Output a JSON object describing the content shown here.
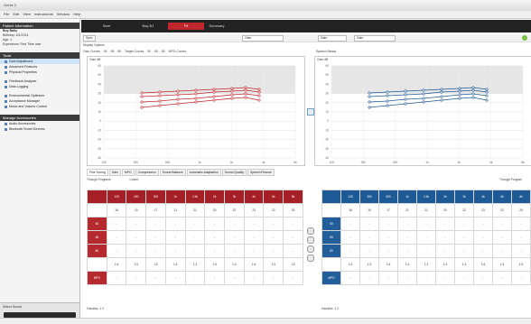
{
  "window": {
    "title": "Genie 2"
  },
  "menu": [
    "File",
    "Edit",
    "View",
    "Instruments",
    "Window",
    "Help"
  ],
  "nav_tabs": [
    {
      "label": "Start",
      "active": false
    },
    {
      "label": "Bay B1",
      "active": false
    },
    {
      "label": "Fit",
      "active": true
    },
    {
      "label": "Summary",
      "active": false
    }
  ],
  "patient": {
    "header": "Patient Information",
    "name": "Boy Baby",
    "birthday": "Birthday: 6/1/2014",
    "age": "Age: 1",
    "experience": "Experience: First Time user"
  },
  "tools": {
    "header": "Tools",
    "items": [
      "Gain Adjustment",
      "Advanced Features",
      "Physical Properties"
    ],
    "extra": [
      "Feedback Analyzer",
      "Data Logging"
    ],
    "more": [
      "Environmental Optimizer",
      "Acceptance Manager",
      "Music and Volume Control"
    ]
  },
  "accessories": {
    "header": "Manage Accessories",
    "items": [
      "Audio Accessories",
      "Bluetooth Smart Devices"
    ]
  },
  "sidebar_bottom": {
    "label": "Select Sound"
  },
  "toolbar": {
    "left_label": "Sync",
    "mid_label": "Gain",
    "mid2_label": "Gain",
    "right_label": "Gain"
  },
  "options": {
    "row1": "Display Options",
    "row1_items": [
      "Gain Curves",
      "50",
      "65",
      "80",
      "Target Curves",
      "50",
      "65",
      "80",
      "MPO Curves"
    ],
    "row2_items": [
      "Speech Spectrum",
      "Curve Cross Curve"
    ],
    "right_option": "Speech Bands"
  },
  "graphs": {
    "left_label": "Gain dB",
    "right_label": "Gain dB",
    "y_ticks": [
      "60",
      "50",
      "40",
      "30",
      "20",
      "10",
      "0",
      "-10",
      "-20",
      "-30",
      "-40"
    ],
    "x_ticks": [
      "125",
      "250",
      "500",
      "1k",
      "2k",
      "4k",
      "8k"
    ]
  },
  "tabs": [
    "Fine Tuning",
    "Gain",
    "MPO",
    "Compression",
    "Sound Balance",
    "Automatic Adaptation",
    "Sound Quality",
    "Speech Rescue"
  ],
  "subrow": {
    "left": "Through Programs",
    "mid": "Linked",
    "right": "Through Program"
  },
  "red_table": {
    "headers": [
      "",
      "125",
      "250",
      "500",
      "1k",
      "1.5k",
      "2k",
      "3k",
      "4k",
      "6k",
      "8k"
    ],
    "rows": [
      {
        "label": "",
        "cells": [
          "18",
          "19",
          "17",
          "21",
          "21",
          "20",
          "22",
          "23",
          "22",
          "20"
        ]
      },
      {
        "label": "50",
        "cells": [
          "-",
          "-",
          "-",
          "-",
          "-",
          "-",
          "-",
          "-",
          "-",
          "-"
        ]
      },
      {
        "label": "65",
        "cells": [
          "-",
          "-",
          "-",
          "-",
          "-",
          "-",
          "-",
          "-",
          "-",
          "-"
        ]
      },
      {
        "label": "80",
        "cells": [
          "-",
          "-",
          "-",
          "-",
          "-",
          "-",
          "-",
          "-",
          "-",
          "-"
        ]
      },
      {
        "label": "",
        "cells": [
          "1.6",
          "1.5",
          "1.6",
          "1.4",
          "1.3",
          "1.5",
          "1.4",
          "1.6",
          "1.5",
          "1.6"
        ]
      },
      {
        "label": "MPO",
        "cells": [
          "-",
          "-",
          "-",
          "-",
          "-",
          "-",
          "-",
          "-",
          "-",
          "-"
        ]
      }
    ]
  },
  "blue_table": {
    "headers": [
      "",
      "125",
      "250",
      "500",
      "1k",
      "1.5k",
      "2k",
      "3k",
      "4k",
      "6k",
      "8k"
    ],
    "rows": [
      {
        "label": "",
        "cells": [
          "18",
          "19",
          "17",
          "21",
          "21",
          "20",
          "22",
          "23",
          "22",
          "20"
        ]
      },
      {
        "label": "50",
        "cells": [
          "-",
          "-",
          "-",
          "-",
          "-",
          "-",
          "-",
          "-",
          "-",
          "-"
        ]
      },
      {
        "label": "65",
        "cells": [
          "-",
          "-",
          "-",
          "-",
          "-",
          "-",
          "-",
          "-",
          "-",
          "-"
        ]
      },
      {
        "label": "80",
        "cells": [
          "-",
          "-",
          "-",
          "-",
          "-",
          "-",
          "-",
          "-",
          "-",
          "-"
        ]
      },
      {
        "label": "",
        "cells": [
          "1.6",
          "1.5",
          "1.6",
          "1.4",
          "1.3",
          "1.5",
          "1.4",
          "1.6",
          "1.5",
          "1.6"
        ]
      },
      {
        "label": "MPO",
        "cells": [
          "-",
          "-",
          "-",
          "-",
          "-",
          "-",
          "-",
          "-",
          "-",
          "-"
        ]
      }
    ]
  },
  "bottom": {
    "left": "Handles: 1 2",
    "right": "Handles: 1 2"
  },
  "colors": {
    "red": "#c0272d",
    "blue": "#1e5a96",
    "dark": "#232323"
  }
}
